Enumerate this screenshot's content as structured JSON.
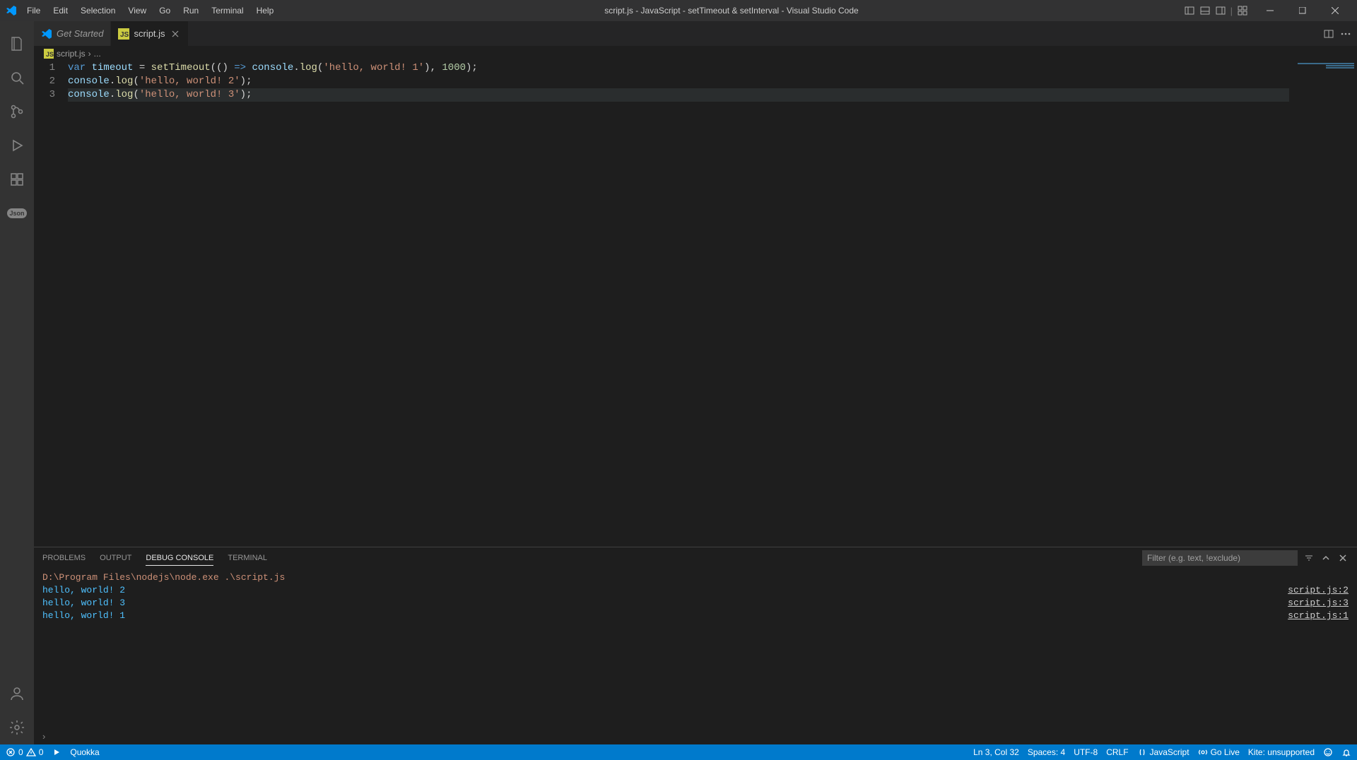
{
  "titlebar": {
    "menus": [
      "File",
      "Edit",
      "Selection",
      "View",
      "Go",
      "Run",
      "Terminal",
      "Help"
    ],
    "title": "script.js - JavaScript - setTimeout & setInterval - Visual Studio Code"
  },
  "tabs": [
    {
      "label": "Get Started",
      "icon": "vscode",
      "active": false
    },
    {
      "label": "script.js",
      "icon": "js",
      "active": true
    }
  ],
  "breadcrumb": {
    "file": "script.js",
    "rest": "..."
  },
  "code": {
    "lines": [
      {
        "n": "1",
        "segments": [
          [
            "kw",
            "var"
          ],
          [
            "plain",
            " "
          ],
          [
            "ident",
            "timeout"
          ],
          [
            "plain",
            " = "
          ],
          [
            "fn",
            "setTimeout"
          ],
          [
            "plain",
            "(() "
          ],
          [
            "kw",
            "=>"
          ],
          [
            "plain",
            " "
          ],
          [
            "ident",
            "console"
          ],
          [
            "plain",
            "."
          ],
          [
            "fn",
            "log"
          ],
          [
            "plain",
            "("
          ],
          [
            "str",
            "'hello, world! 1'"
          ],
          [
            "plain",
            ")"
          ],
          [
            "plain",
            ", "
          ],
          [
            "num",
            "1000"
          ],
          [
            "plain",
            ");"
          ]
        ]
      },
      {
        "n": "2",
        "segments": [
          [
            "ident",
            "console"
          ],
          [
            "plain",
            "."
          ],
          [
            "fn",
            "log"
          ],
          [
            "plain",
            "("
          ],
          [
            "str",
            "'hello, world! 2'"
          ],
          [
            "plain",
            ");"
          ]
        ]
      },
      {
        "n": "3",
        "segments": [
          [
            "ident",
            "console"
          ],
          [
            "plain",
            "."
          ],
          [
            "fn",
            "log"
          ],
          [
            "plain",
            "("
          ],
          [
            "str",
            "'hello, world! 3'"
          ],
          [
            "plain",
            ");"
          ]
        ],
        "current": true
      }
    ]
  },
  "panel": {
    "tabs": [
      "PROBLEMS",
      "OUTPUT",
      "DEBUG CONSOLE",
      "TERMINAL"
    ],
    "active_tab": "DEBUG CONSOLE",
    "filter_placeholder": "Filter (e.g. text, !exclude)",
    "output": [
      {
        "msg": "D:\\Program Files\\nodejs\\node.exe .\\script.js",
        "cls": "cmd",
        "src": ""
      },
      {
        "msg": "hello, world! 2",
        "cls": "log",
        "src": "script.js:2"
      },
      {
        "msg": "hello, world! 3",
        "cls": "log",
        "src": "script.js:3"
      },
      {
        "msg": "hello, world! 1",
        "cls": "log",
        "src": "script.js:1"
      }
    ]
  },
  "statusbar": {
    "errors": "0",
    "warnings": "0",
    "quokka": "Quokka",
    "cursor": "Ln 3, Col 32",
    "spaces": "Spaces: 4",
    "encoding": "UTF-8",
    "eol": "CRLF",
    "lang": "JavaScript",
    "golive": "Go Live",
    "kite": "Kite: unsupported"
  }
}
